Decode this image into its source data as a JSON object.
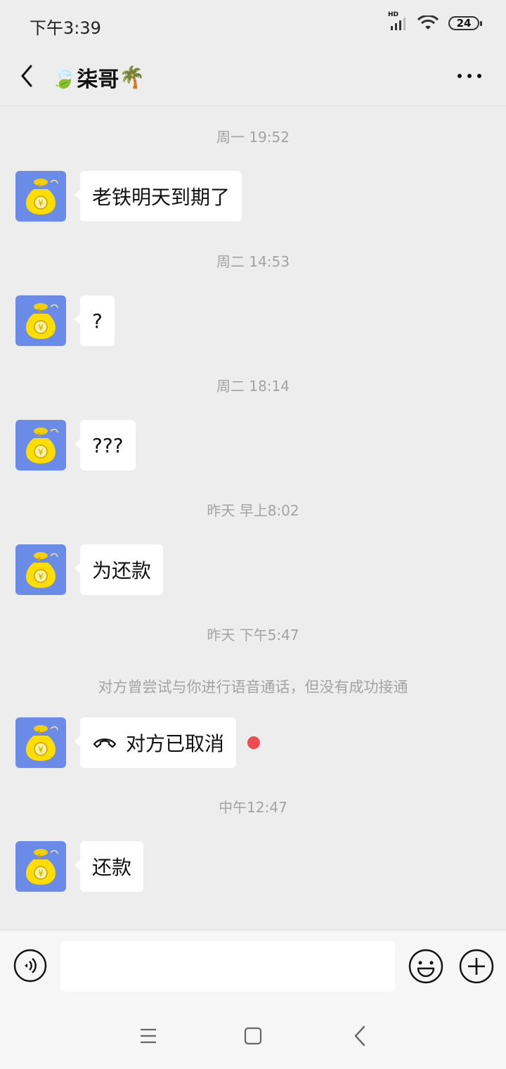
{
  "status_bar": {
    "time": "下午3:39",
    "network": "HD",
    "battery": "24"
  },
  "header": {
    "title": "柒哥",
    "title_prefix_emoji": "🍃",
    "title_suffix_emoji": "🌴"
  },
  "messages": [
    {
      "time": "周一 19:52",
      "text": "老铁明天到期了"
    },
    {
      "time": "周二 14:53",
      "text": "?"
    },
    {
      "time": "周二 18:14",
      "text": "???"
    },
    {
      "time": "昨天 早上8:02",
      "text": "为还款"
    },
    {
      "time": "昨天 下午5:47",
      "system": "对方曾尝试与你进行语音通话，但没有成功接通",
      "text": "对方已取消",
      "call": true,
      "unread": true
    },
    {
      "time": "中午12:47",
      "text": "还款"
    }
  ],
  "colors": {
    "background": "#ededed",
    "bubble": "#ffffff",
    "avatar_bg": "#6a8ce8",
    "unread": "#f04b50",
    "timestamp": "#a3a3a3"
  }
}
